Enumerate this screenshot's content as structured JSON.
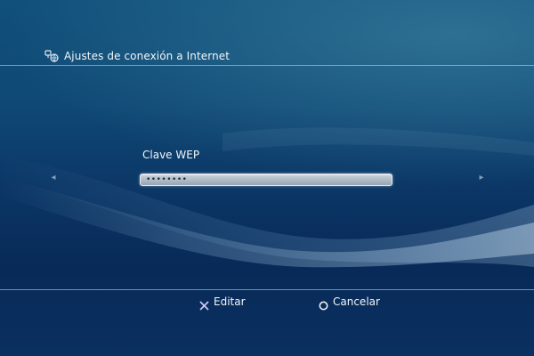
{
  "header": {
    "title": "Ajustes de conexión a Internet",
    "icon": "network-settings-icon"
  },
  "field": {
    "label": "Clave WEP",
    "value": "••••••••"
  },
  "nav": {
    "left_icon": "arrow-left-icon",
    "right_icon": "arrow-right-icon",
    "left_glyph": "◂",
    "right_glyph": "▸"
  },
  "footer": {
    "edit_label": "Editar",
    "cancel_label": "Cancelar"
  },
  "colors": {
    "accent_text": "#f2f6fa",
    "field_bg": "#b4bfca",
    "cross_button": "#c8c8f0",
    "circle_button": "#f0f0f0"
  }
}
